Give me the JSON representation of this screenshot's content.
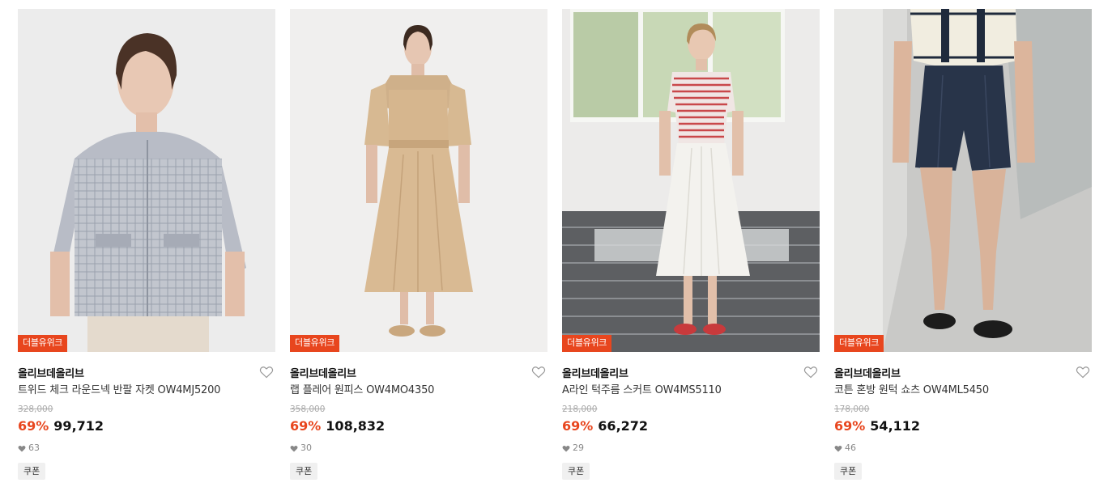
{
  "products": [
    {
      "badge": "더블유위크",
      "brand": "올리브데올리브",
      "name": "트위드 체크 라운드넥 반팔 자켓 OW4MJ5200",
      "original_price": "328,000",
      "discount": "69%",
      "price": "99,712",
      "likes": "63",
      "coupon": "쿠폰"
    },
    {
      "badge": "더블유위크",
      "brand": "올리브데올리브",
      "name": "랩 플레어 원피스 OW4MO4350",
      "original_price": "358,000",
      "discount": "69%",
      "price": "108,832",
      "likes": "30",
      "coupon": "쿠폰"
    },
    {
      "badge": "더블유위크",
      "brand": "올리브데올리브",
      "name": "A라인 턱주름 스커트 OW4MS5110",
      "original_price": "218,000",
      "discount": "69%",
      "price": "66,272",
      "likes": "29",
      "coupon": "쿠폰"
    },
    {
      "badge": "더블유위크",
      "brand": "올리브데올리브",
      "name": "코튼 혼방 원턱 쇼츠 OW4ML5450",
      "original_price": "178,000",
      "discount": "69%",
      "price": "54,112",
      "likes": "46",
      "coupon": "쿠폰"
    }
  ],
  "colors": {
    "accent": "#e8461e",
    "muted": "#aaaaaa"
  },
  "icons": {
    "wishlist": "heart-outline-icon",
    "likes": "heart-filled-icon"
  }
}
